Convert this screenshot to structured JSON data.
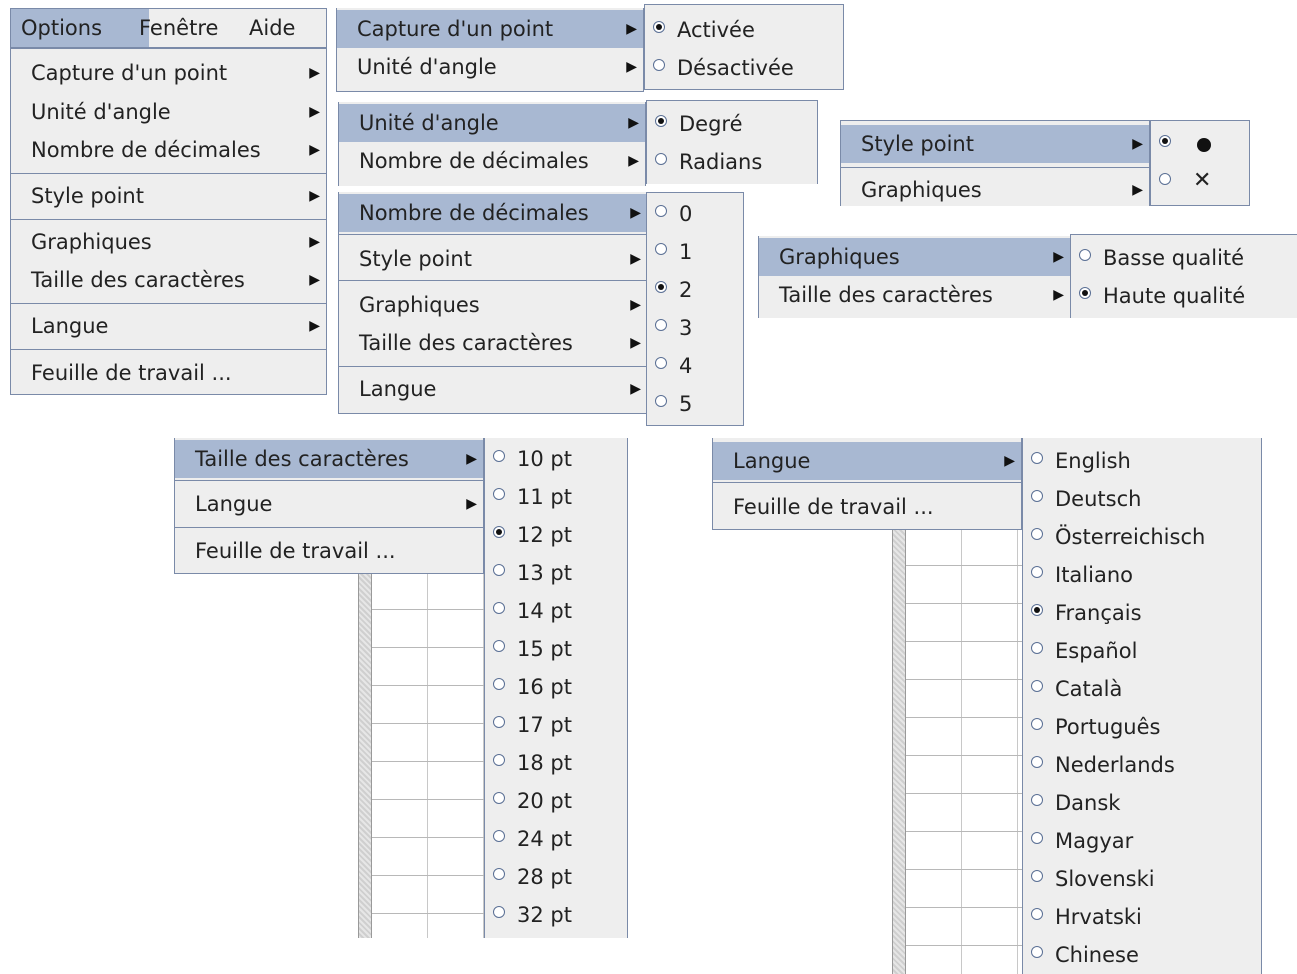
{
  "menubar": {
    "options": "Options",
    "fenetre": "Fenêtre",
    "aide": "Aide"
  },
  "options_menu": {
    "capture": "Capture d'un point",
    "unite": "Unité d'angle",
    "decimales": "Nombre de décimales",
    "style": "Style point",
    "graphiques": "Graphiques",
    "taille": "Taille des caractères",
    "langue": "Langue",
    "feuille": "Feuille de travail ..."
  },
  "capture_sub": {
    "activee": "Activée",
    "desactivee": "Désactivée",
    "selected": "Activée"
  },
  "angle_sub": {
    "degre": "Degré",
    "radians": "Radians",
    "selected": "Degré"
  },
  "decimals_sub": {
    "items": [
      "0",
      "1",
      "2",
      "3",
      "4",
      "5"
    ],
    "selected": "2"
  },
  "style_sub": {
    "selected": "filled-circle",
    "icons": [
      "filled-circle-icon",
      "cross-icon"
    ]
  },
  "graphics_sub": {
    "basse": "Basse qualité",
    "haute": "Haute qualité",
    "selected": "Haute qualité"
  },
  "fontsize_sub": {
    "items": [
      "10 pt",
      "11 pt",
      "12 pt",
      "13 pt",
      "14 pt",
      "15 pt",
      "16 pt",
      "17 pt",
      "18 pt",
      "20 pt",
      "24 pt",
      "28 pt",
      "32 pt"
    ],
    "selected": "12 pt"
  },
  "language_sub": {
    "items": [
      "English",
      "Deutsch",
      "Österreichisch",
      "Italiano",
      "Français",
      "Español",
      "Català",
      "Português",
      "Nederlands",
      "Dansk",
      "Magyar",
      "Slovenski",
      "Hrvatski",
      "Chinese"
    ],
    "selected": "Français"
  },
  "colors": {
    "menu_bg": "#eeeeee",
    "selection": "#a8b8d2",
    "border": "#7a8aa8"
  }
}
